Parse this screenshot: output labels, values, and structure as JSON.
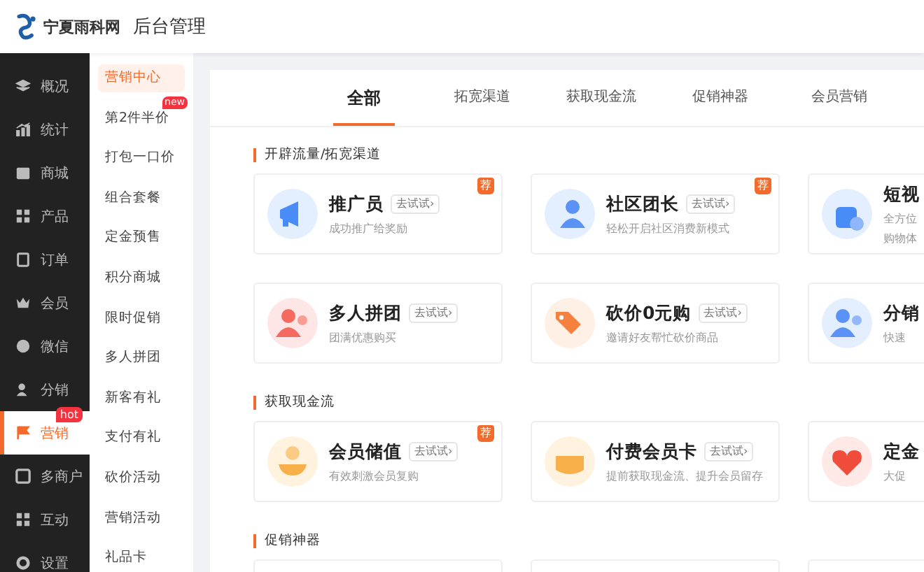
{
  "header": {
    "logo_text": "宁夏雨科网",
    "title": "后台管理"
  },
  "nav": [
    {
      "label": "概况",
      "selected": false
    },
    {
      "label": "统计",
      "selected": false
    },
    {
      "label": "商城",
      "selected": false
    },
    {
      "label": "产品",
      "selected": false
    },
    {
      "label": "订单",
      "selected": false
    },
    {
      "label": "会员",
      "selected": false
    },
    {
      "label": "微信",
      "selected": false
    },
    {
      "label": "分销",
      "selected": false
    },
    {
      "label": "营销",
      "selected": true,
      "badge": "hot"
    },
    {
      "label": "多商户",
      "selected": false
    },
    {
      "label": "互动",
      "selected": false
    },
    {
      "label": "设置",
      "selected": false
    }
  ],
  "submenu": [
    {
      "label": "营销中心",
      "selected": true
    },
    {
      "label": "第2件半价",
      "selected": false,
      "badge": "new"
    },
    {
      "label": "打包一口价",
      "selected": false
    },
    {
      "label": "组合套餐",
      "selected": false
    },
    {
      "label": "定金预售",
      "selected": false
    },
    {
      "label": "积分商城",
      "selected": false
    },
    {
      "label": "限时促销",
      "selected": false
    },
    {
      "label": "多人拼团",
      "selected": false
    },
    {
      "label": "新客有礼",
      "selected": false
    },
    {
      "label": "支付有礼",
      "selected": false
    },
    {
      "label": "砍价活动",
      "selected": false
    },
    {
      "label": "营销活动",
      "selected": false
    },
    {
      "label": "礼品卡",
      "selected": false
    }
  ],
  "tabs": [
    {
      "label": "全部",
      "selected": true
    },
    {
      "label": "拓宽渠道",
      "selected": false
    },
    {
      "label": "获取现金流",
      "selected": false
    },
    {
      "label": "促销神器",
      "selected": false
    },
    {
      "label": "会员营销",
      "selected": false
    }
  ],
  "sections": [
    {
      "title": "开辟流量/拓宽渠道",
      "cards": [
        {
          "name": "推广员",
          "action": "去试试›",
          "description": [
            "成功推广给奖励"
          ],
          "tag": "荐"
        },
        {
          "name": "社区团长",
          "action": "去试试›",
          "description": [
            "轻松开启社区消费新模式"
          ],
          "tag": "荐"
        },
        {
          "name": "短视",
          "description": [
            "全方位",
            "购物体"
          ]
        },
        {
          "name": "多人拼团",
          "action": "去试试›",
          "description": [
            "团满优惠购买"
          ]
        },
        {
          "name": "砍价0元购",
          "action": "去试试›",
          "description": [
            "邀请好友帮忙砍价商品"
          ]
        },
        {
          "name": "分销",
          "description": [
            "快速"
          ]
        }
      ]
    },
    {
      "title": "获取现金流",
      "cards": [
        {
          "name": "会员储值",
          "action": "去试试›",
          "description": [
            "有效刺激会员复购"
          ],
          "tag": "荐"
        },
        {
          "name": "付费会员卡",
          "action": "去试试›",
          "description": [
            "提前获取现金流、提升会员留存"
          ]
        },
        {
          "name": "定金",
          "description": [
            "大促"
          ]
        }
      ]
    },
    {
      "title": "促销神器"
    }
  ]
}
